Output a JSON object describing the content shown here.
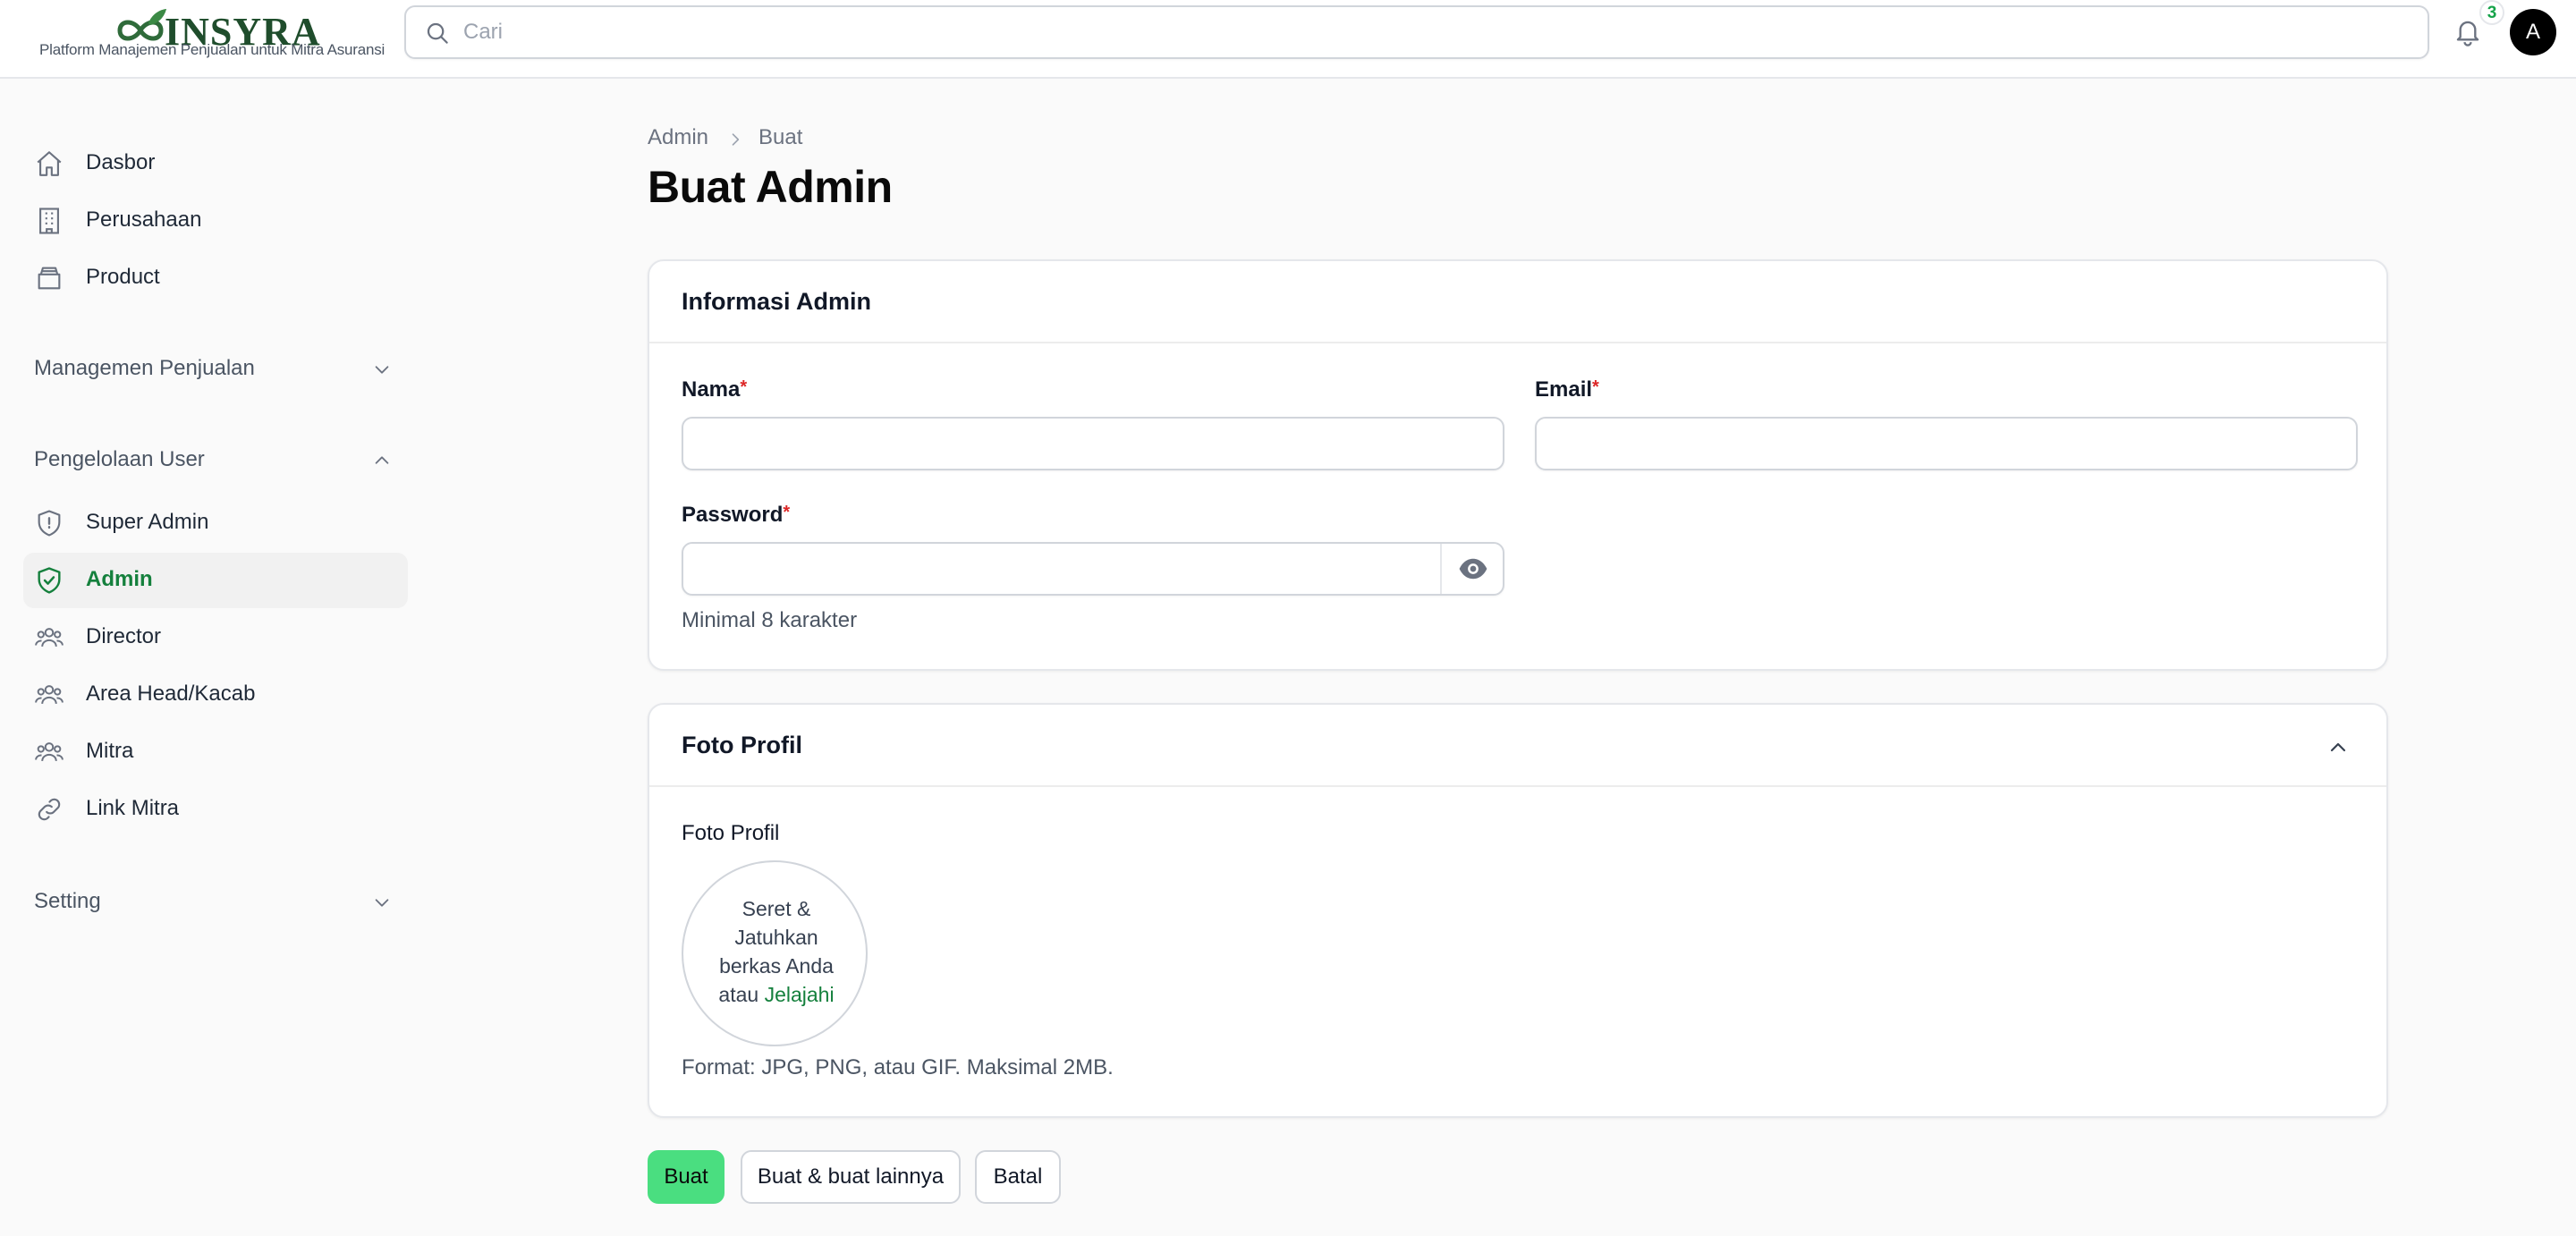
{
  "header": {
    "brand": "INSYRA",
    "tagline": "Platform Manajemen Penjualan untuk Mitra Asuransi",
    "search_placeholder": "Cari",
    "notification_count": "3",
    "avatar_initial": "A"
  },
  "sidebar": {
    "items": [
      {
        "label": "Dasbor",
        "icon": "home-icon"
      },
      {
        "label": "Perusahaan",
        "icon": "building-icon"
      },
      {
        "label": "Product",
        "icon": "box-icon"
      }
    ],
    "groups": {
      "sales": {
        "label": "Managemen Penjualan",
        "expanded": false
      },
      "users": {
        "label": "Pengelolaan User",
        "expanded": true,
        "items": [
          {
            "label": "Super Admin",
            "icon": "shield-icon"
          },
          {
            "label": "Admin",
            "icon": "shield-check-icon",
            "active": true
          },
          {
            "label": "Director",
            "icon": "users-icon"
          },
          {
            "label": "Area Head/Kacab",
            "icon": "users-icon"
          },
          {
            "label": "Mitra",
            "icon": "users-icon"
          },
          {
            "label": "Link Mitra",
            "icon": "link-icon"
          }
        ]
      },
      "setting": {
        "label": "Setting",
        "expanded": false
      }
    }
  },
  "main": {
    "breadcrumb": [
      "Admin",
      "Buat"
    ],
    "title": "Buat Admin",
    "info_section": {
      "title": "Informasi Admin",
      "name_label": "Nama",
      "name_value": "",
      "email_label": "Email",
      "email_value": "",
      "password_label": "Password",
      "password_value": "",
      "password_hint": "Minimal 8 karakter",
      "required_mark": "*"
    },
    "photo_section": {
      "title": "Foto Profil",
      "field_label": "Foto Profil",
      "dropzone_text": "Seret & Jatuhkan berkas Anda atau",
      "dropzone_link": "Jelajahi",
      "format_hint": "Format: JPG, PNG, atau GIF. Maksimal 2MB."
    },
    "actions": {
      "create": "Buat",
      "create_another": "Buat & buat lainnya",
      "cancel": "Batal"
    }
  },
  "colors": {
    "accent": "#15803d",
    "primary_button": "#4ade80",
    "required": "#dc2626"
  }
}
